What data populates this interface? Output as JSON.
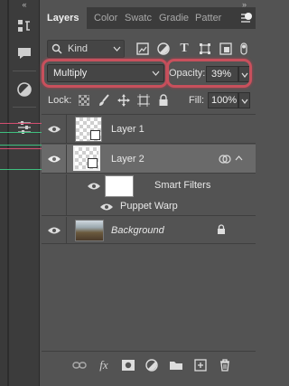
{
  "tabs": [
    "Layers",
    "Color",
    "Swatc",
    "Gradie",
    "Patter"
  ],
  "filter": {
    "kind_label": "Kind"
  },
  "blend": {
    "mode": "Multiply",
    "opacity_label": "Opacity:",
    "opacity_value": "39%"
  },
  "lock": {
    "label": "Lock:",
    "fill_label": "Fill:",
    "fill_value": "100%"
  },
  "layers": [
    {
      "name": "Layer 1"
    },
    {
      "name": "Layer 2"
    },
    {
      "name": "Smart Filters"
    },
    {
      "name": "Puppet Warp"
    },
    {
      "name": "Background"
    }
  ],
  "colors": {
    "highlight": "#c8505c",
    "panel": "#535353",
    "selected_row": "#6a6a6a"
  }
}
